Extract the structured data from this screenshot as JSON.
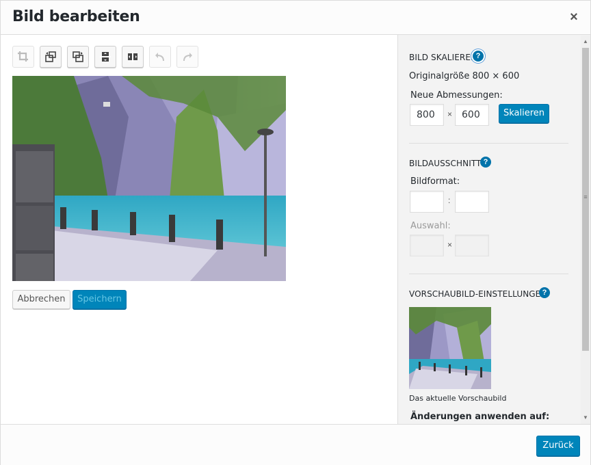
{
  "dialog": {
    "title": "Bild bearbeiten",
    "close_glyph": "×"
  },
  "toolbar": {
    "items": [
      {
        "name": "crop-icon",
        "state": "disabled"
      },
      {
        "name": "rotate-left-icon",
        "state": "enabled"
      },
      {
        "name": "rotate-right-icon",
        "state": "enabled"
      },
      {
        "name": "flip-vertical-icon",
        "state": "enabled"
      },
      {
        "name": "flip-horizontal-icon",
        "state": "enabled"
      },
      {
        "name": "undo-icon",
        "state": "disabled"
      },
      {
        "name": "redo-icon",
        "state": "disabled"
      }
    ]
  },
  "editor": {
    "cancel_label": "Abbrechen",
    "save_label": "Speichern"
  },
  "sidebar": {
    "scale": {
      "title": "Bild skalieren",
      "help": "?",
      "original_size": "Originalgröße 800 × 600",
      "new_dims_label": "Neue Abmessungen:",
      "width": "800",
      "height": "600",
      "times": "×",
      "button_label": "Skalieren"
    },
    "crop": {
      "title": "Bildausschnitt",
      "help": "?",
      "aspect_label": "Bildformat:",
      "aspect_w": "",
      "aspect_h": "",
      "colon": ":",
      "selection_label": "Auswahl:",
      "sel_w": "",
      "sel_h": "",
      "times": "×"
    },
    "thumbnail": {
      "title": "Vorschaubild-Einstellungen",
      "help": "?",
      "caption": "Das aktuelle Vorschaubild",
      "apply_label": "Änderungen anwenden auf:"
    }
  },
  "footer": {
    "back_label": "Zurück"
  },
  "colors": {
    "primary": "#0085ba",
    "help": "#0073aa",
    "water": "#3ab3c9",
    "cliff": "#7a78a8"
  }
}
